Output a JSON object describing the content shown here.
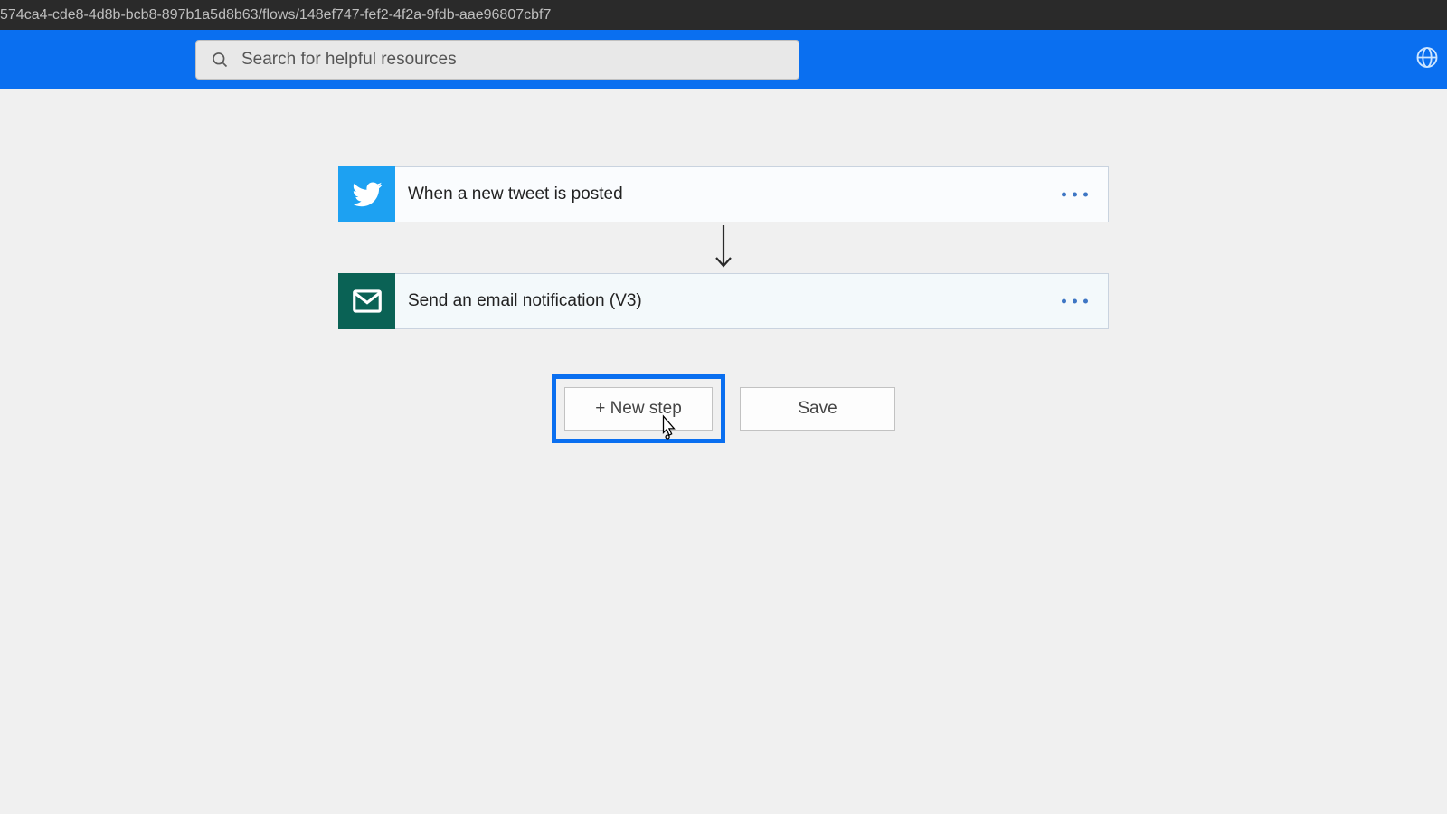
{
  "address_bar": {
    "url": "574ca4-cde8-4d8b-bcb8-897b1a5d8b63/flows/148ef747-fef2-4f2a-9fdb-aae96807cbf7"
  },
  "header": {
    "search_placeholder": "Search for helpful resources"
  },
  "flow": {
    "steps": [
      {
        "title": "When a new tweet is posted",
        "icon": "twitter"
      },
      {
        "title": "Send an email notification (V3)",
        "icon": "mail"
      }
    ]
  },
  "buttons": {
    "new_step": "+ New step",
    "save": "Save"
  }
}
